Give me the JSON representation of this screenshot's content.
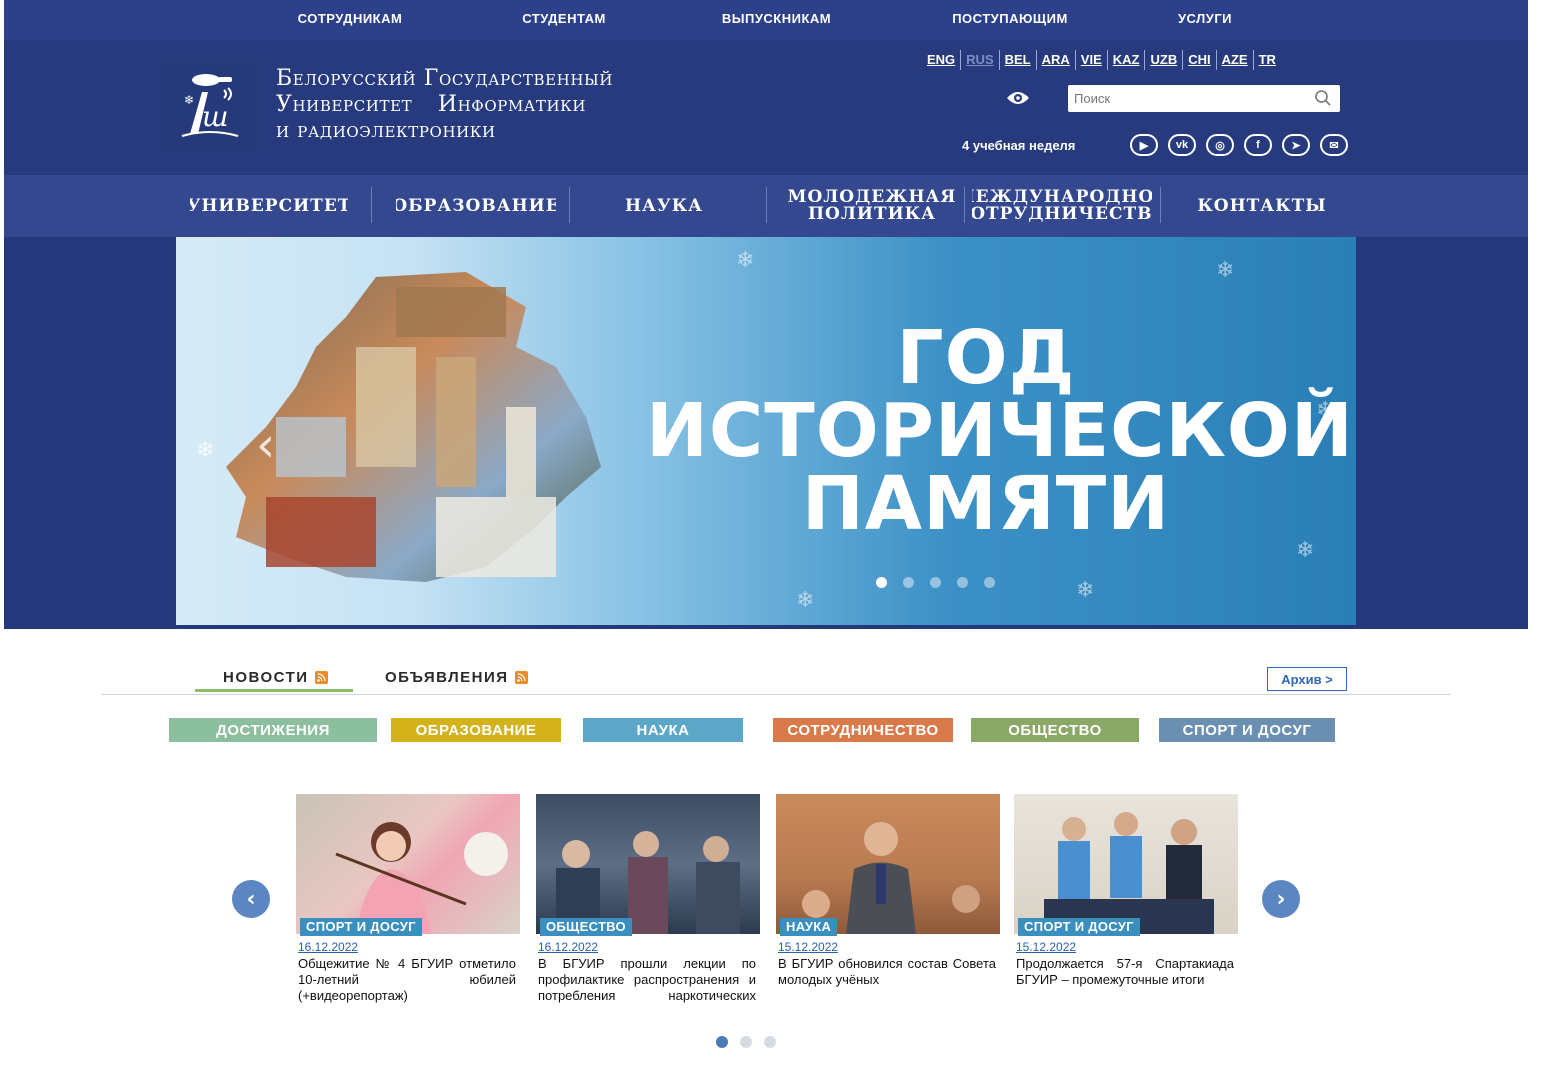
{
  "topbar": {
    "links": [
      "СОТРУДНИКАМ",
      "СТУДЕНТАМ",
      "ВЫПУСКНИКАМ",
      "ПОСТУПАЮЩИМ",
      "УСЛУГИ"
    ]
  },
  "header": {
    "logo_lines": [
      "Белорусский Государственный",
      "Университет Информатики",
      "и радиоэлектроники"
    ],
    "languages": [
      "ENG",
      "RUS",
      "BEL",
      "ARA",
      "VIE",
      "KAZ",
      "UZB",
      "CHI",
      "AZE",
      "TR"
    ],
    "active_language": "RUS",
    "search_placeholder": "Поиск",
    "week": "4 учебная неделя",
    "socials": [
      "youtube-icon",
      "vk-icon",
      "instagram-icon",
      "facebook-icon",
      "telegram-icon",
      "mail-icon"
    ]
  },
  "nav": {
    "items": [
      "УНИВЕРСИТЕТ",
      "ОБРАЗОВАНИЕ",
      "НАУКА",
      "МОЛОДЕЖНАЯ ПОЛИТИКА",
      "МЕЖДУНАРОДНОЕ СОТРУДНИЧЕСТВО",
      "КОНТАКТЫ"
    ]
  },
  "hero": {
    "title": "ГОД ИСТОРИЧЕСКОЙ ПАМЯТИ",
    "slides": 5,
    "active_slide": 1
  },
  "news": {
    "tabs": [
      "НОВОСТИ",
      "ОБЪЯВЛЕНИЯ"
    ],
    "archive": "Архив >",
    "categories": [
      {
        "label": "ДОСТИЖЕНИЯ",
        "color": "#8bbf9e"
      },
      {
        "label": "ОБРАЗОВАНИЕ",
        "color": "#d4b21c"
      },
      {
        "label": "НАУКА",
        "color": "#5ca7c8"
      },
      {
        "label": "СОТРУДНИЧЕСТВО",
        "color": "#d97a4a"
      },
      {
        "label": "ОБЩЕСТВО",
        "color": "#8aa866"
      },
      {
        "label": "СПОРТ И ДОСУГ",
        "color": "#6a8fb0"
      }
    ],
    "cards": [
      {
        "category": "СПОРТ И ДОСУГ",
        "date": "16.12.2022",
        "text": "Общежитие № 4 БГУИР отметило 10-летний юбилей (+видеорепортаж)"
      },
      {
        "category": "ОБЩЕСТВО",
        "date": "16.12.2022",
        "text": "В БГУИР прошли лекции по профилактике распространения и потребления наркотических средств"
      },
      {
        "category": "НАУКА",
        "date": "15.12.2022",
        "text": "В БГУИР обновился состав Совета молодых учёных"
      },
      {
        "category": "СПОРТ И ДОСУГ",
        "date": "15.12.2022",
        "text": "Продолжается 57-я Спартакиада БГУИР – промежуточные итоги"
      }
    ],
    "pages": 3,
    "active_page": 1
  }
}
